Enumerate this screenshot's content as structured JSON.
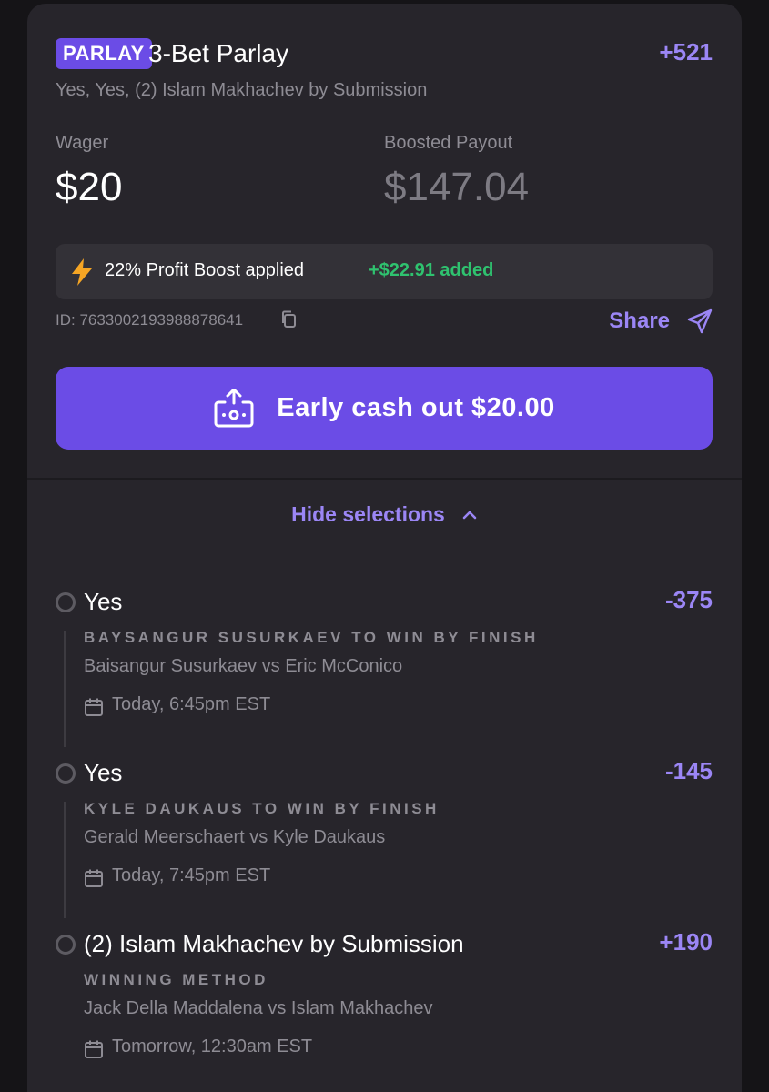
{
  "header": {
    "badge": "PARLAY",
    "title": "3-Bet Parlay",
    "odds": "+521",
    "subtitle": "Yes, Yes, (2) Islam Makhachev by Submission"
  },
  "wager": {
    "label": "Wager",
    "value": "$20"
  },
  "payout": {
    "label": "Boosted Payout",
    "value": "$147.04"
  },
  "boost": {
    "icon": "lightning-bolt-icon",
    "text": "22% Profit Boost applied",
    "added": "+$22.91 added",
    "colors": {
      "added": "#2fc26f",
      "bolt": "#f5a524"
    }
  },
  "bet_id": "ID: 7633002193988878641",
  "share": {
    "label": "Share",
    "icon": "send-icon"
  },
  "cashout": {
    "label": "Early cash out $20.00",
    "icon": "cash-out-icon"
  },
  "selections_toggle": {
    "label": "Hide selections",
    "icon": "chevron-up-icon"
  },
  "legs": [
    {
      "selection": "Yes",
      "odds": "-375",
      "market": "BAYSANGUR SUSURKAEV TO WIN BY FINISH",
      "matchup": "Baisangur Susurkaev vs Eric McConico",
      "time": "Today, 6:45pm EST"
    },
    {
      "selection": "Yes",
      "odds": "-145",
      "market": "KYLE DAUKAUS TO WIN BY FINISH",
      "matchup": "Gerald Meerschaert vs Kyle Daukaus",
      "time": "Today, 7:45pm EST"
    },
    {
      "selection": "(2) Islam Makhachev by Submission",
      "odds": "+190",
      "market": "WINNING METHOD",
      "matchup": "Jack Della Maddalena vs Islam Makhachev",
      "time": "Tomorrow, 12:30am EST"
    }
  ],
  "colors": {
    "accent": "#6b4ce6",
    "accent_text": "#9b86f5",
    "card": "#27252b",
    "background": "#151417"
  }
}
